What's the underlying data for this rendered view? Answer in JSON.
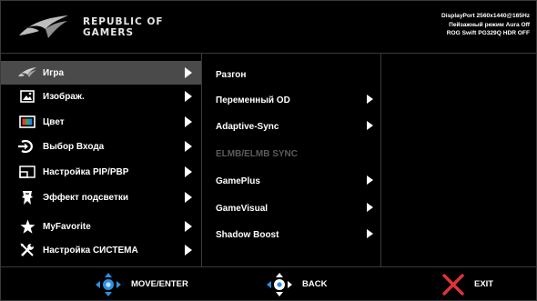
{
  "brand": {
    "line1": "REPUBLIC OF",
    "line2": "GAMERS"
  },
  "status": {
    "line1": "DisplayPort 2560x1440@165Hz",
    "line2": "Пейзажный режим Aura Off",
    "line3": "ROG Swift PG329Q HDR OFF"
  },
  "main_menu": {
    "selected": "Игра",
    "items": [
      {
        "label": "Игра",
        "icon": "rog-eye-icon"
      },
      {
        "label": "Изображ.",
        "icon": "image-icon"
      },
      {
        "label": "Цвет",
        "icon": "color-icon"
      },
      {
        "label": "Выбор Входа",
        "icon": "input-select-icon"
      },
      {
        "label": "Настройка PIP/PBP",
        "icon": "pip-icon"
      },
      {
        "label": "Эффект подсветки",
        "icon": "lighting-effect-icon"
      },
      {
        "label": "MyFavorite",
        "icon": "star-icon"
      },
      {
        "label": "Настройка СИСТЕМА",
        "icon": "tools-icon"
      }
    ]
  },
  "sub_menu": {
    "items": [
      {
        "label": "Разгон",
        "has_arrow": false,
        "enabled": true
      },
      {
        "label": "Переменный OD",
        "has_arrow": true,
        "enabled": true
      },
      {
        "label": "Adaptive-Sync",
        "has_arrow": true,
        "enabled": true
      },
      {
        "label": "ELMB/ELMB SYNC",
        "has_arrow": false,
        "enabled": false
      },
      {
        "label": "GamePlus",
        "has_arrow": true,
        "enabled": true
      },
      {
        "label": "GameVisual",
        "has_arrow": true,
        "enabled": true
      },
      {
        "label": "Shadow Boost",
        "has_arrow": true,
        "enabled": true
      }
    ]
  },
  "footer": {
    "move_label": "MOVE/ENTER",
    "back_label": "BACK",
    "exit_label": "EXIT"
  },
  "colors": {
    "background": "#000000",
    "selected_row": "#4a4a4a",
    "joystick_blue": "#2f8fe0",
    "exit_red": "#e2323a",
    "disabled_text": "#5b5b5b"
  }
}
